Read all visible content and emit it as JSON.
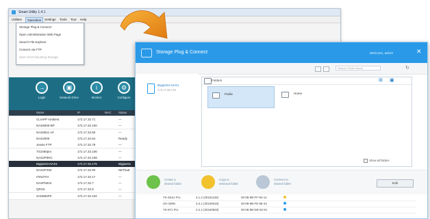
{
  "back_window": {
    "title": "Smart Utility 1.4.1",
    "menu": [
      "Utilities",
      "Operation",
      "Settings",
      "Tools",
      "Tour",
      "Help"
    ],
    "dropdown": [
      {
        "label": "Storage Plug & Connect",
        "disabled": false
      },
      {
        "label": "Open Administration Web Page",
        "disabled": false
      },
      {
        "label": "Search File Explorer",
        "disabled": false
      },
      {
        "label": "Connect via FTP",
        "disabled": false
      },
      {
        "label": "Open NAS Mounting Storage",
        "disabled": true
      }
    ],
    "toolbar": [
      {
        "icon": "login-icon",
        "label": "Login",
        "glyph": "→"
      },
      {
        "icon": "connect-icon",
        "label": "Network Drive",
        "glyph": "▣"
      },
      {
        "icon": "info-icon",
        "label": "Monitor",
        "glyph": "i"
      },
      {
        "icon": "gear-icon",
        "label": "Configure",
        "glyph": "⚙"
      }
    ],
    "table_headers": [
      "Name",
      "IP",
      "MAC",
      "Status"
    ],
    "rows": [
      {
        "name": "CLIAPP Ambient",
        "ip": "172.17.32.71",
        "status": "—",
        "selected": false
      },
      {
        "name": "NAS9000-BP",
        "ip": "172.17.32.100",
        "status": "—",
        "selected": false
      },
      {
        "name": "NAS9911-AF",
        "ip": "172.17.32.50",
        "status": "—",
        "selected": false
      },
      {
        "name": "NAS2000",
        "ip": "172.17.32.64",
        "status": "Ready",
        "selected": false
      },
      {
        "name": "Jessie FTP",
        "ip": "172.17.32.78",
        "status": "—",
        "selected": false
      },
      {
        "name": "TS1060pro",
        "ip": "172.17.32.106",
        "status": "—",
        "selected": false
      },
      {
        "name": "NAS2P0NC",
        "ip": "172.17.32.108",
        "status": "—",
        "selected": false
      },
      {
        "name": "Bigipetra-NAS1",
        "ip": "172.17.32.175",
        "status": "Bigipetra",
        "selected": true
      },
      {
        "name": "NAS3FX94",
        "ip": "172.17.32.90",
        "status": "NETbutt",
        "selected": false
      },
      {
        "name": "ITINOTH",
        "ip": "172.17.32.17",
        "status": "—",
        "selected": false
      },
      {
        "name": "NASP5910",
        "ip": "172.17.32.7",
        "status": "—",
        "selected": false
      },
      {
        "name": "QRSS",
        "ip": "172.17.32.9",
        "status": "—",
        "selected": false
      },
      {
        "name": "SAN850P0",
        "ip": "172.17.32.102",
        "status": "—",
        "selected": false
      }
    ]
  },
  "front_window": {
    "title": "Storage Plug & Connect",
    "user": "Welcome, admin",
    "search_placeholder": "Search Folder Name",
    "device": {
      "name": "Bigipetra NAS1",
      "ip": "172.17.32.175"
    },
    "folder_header": "Folders",
    "folders": [
      {
        "name": "Public",
        "selected": true
      },
      {
        "name": "Home",
        "selected": false
      }
    ],
    "show_all": "Show all folders",
    "actions": [
      {
        "line1": "Create a",
        "line2": "shared folder",
        "color": "#6cc24a"
      },
      {
        "line1": "Copy to",
        "line2": "selected folder",
        "color": "#f2c12e"
      },
      {
        "line1": "Connect to",
        "line2": "shared folder",
        "color": "#b9c7d6"
      }
    ],
    "edit_label": "Edit",
    "list": [
      {
        "model": "TS-451U Pro",
        "ver": "4.1.2 (20151126)",
        "mac": "00-08-9B-FF-94-12",
        "dot": "#f2c12e"
      },
      {
        "model": "SS-439N",
        "ver": "3.3.1 (20150618)",
        "mac": "00-08-9B-FE-58-44",
        "dot": "#2a9ae8"
      },
      {
        "model": "TS-871 Pro",
        "ver": "4.2.1 (20160503)",
        "mac": "00-08-9B-DE-52-91",
        "dot": "#2a9ae8"
      }
    ]
  }
}
